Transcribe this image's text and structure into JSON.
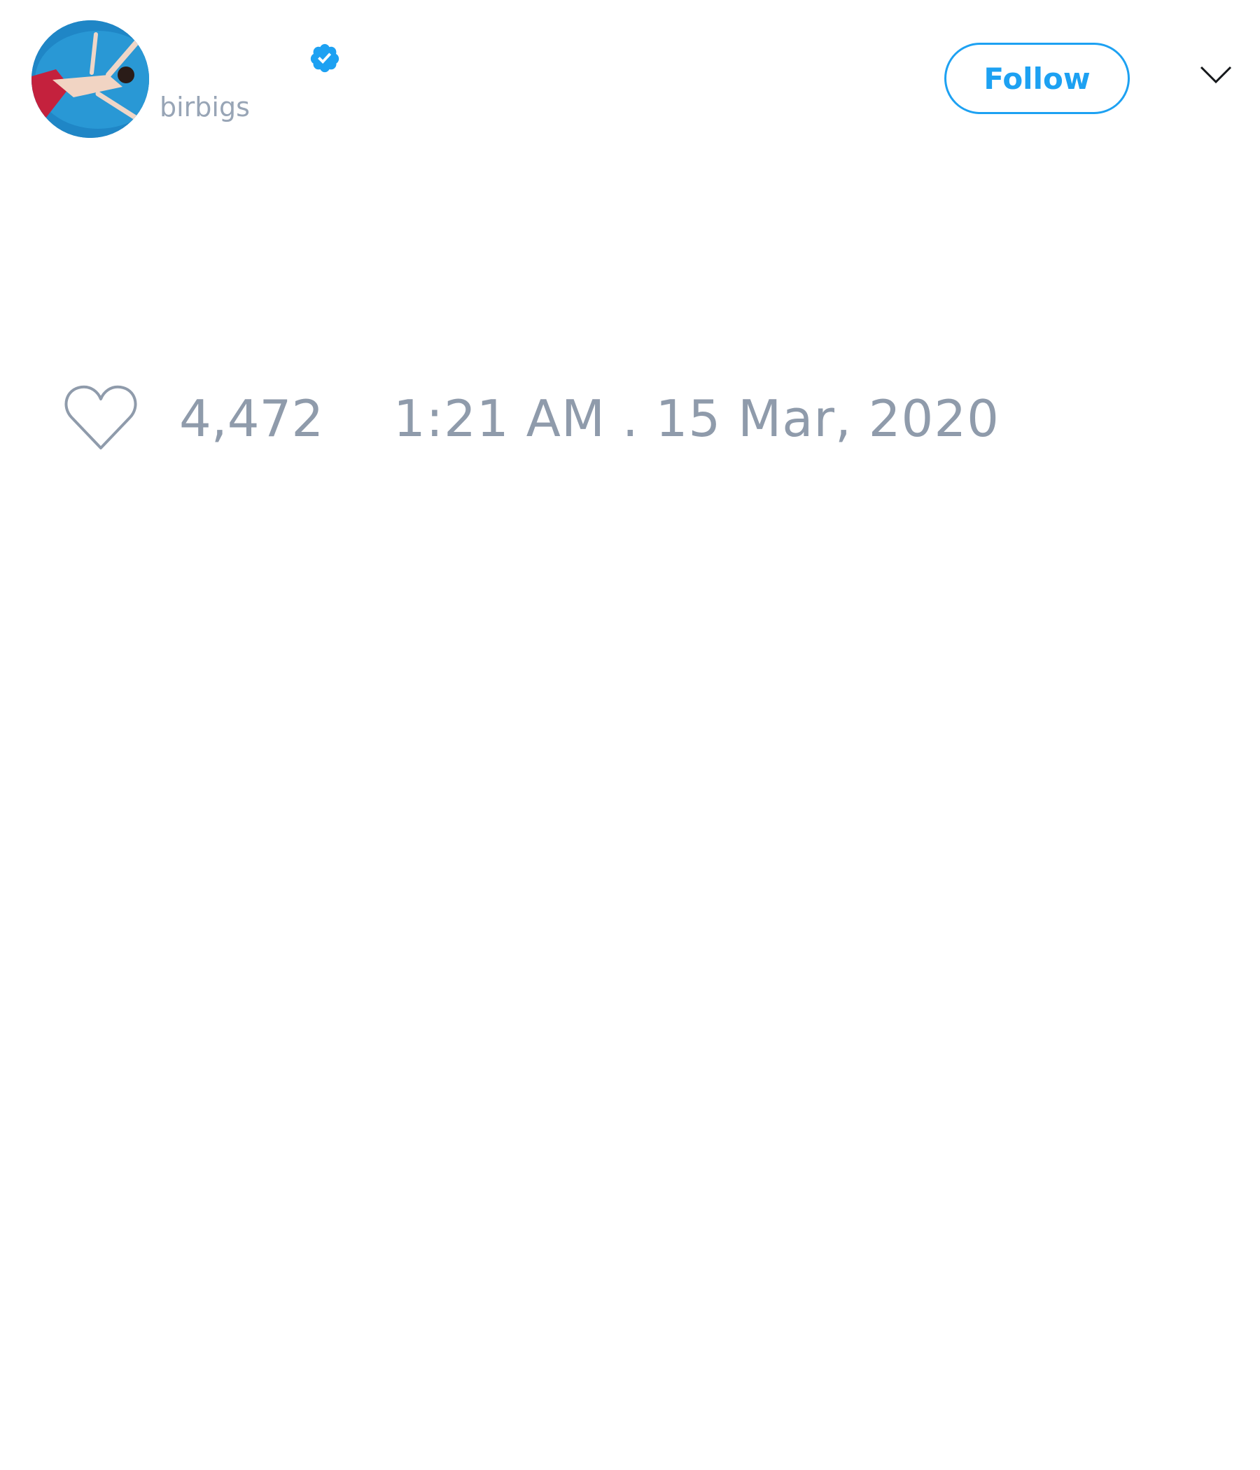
{
  "author": {
    "display_name": "",
    "handle": "birbigs",
    "avatar_icon": "avatar-photo",
    "verified_icon": "verified-badge-icon"
  },
  "actions": {
    "follow_label": "Follow",
    "menu_icon": "chevron-down-icon"
  },
  "tweet": {
    "like_icon": "heart-icon",
    "like_count": "4,472",
    "timestamp": "1:21 AM . 15 Mar, 2020"
  },
  "colors": {
    "accent": "#1da1f2",
    "muted_text": "#8f9bab",
    "background": "#ffffff"
  }
}
